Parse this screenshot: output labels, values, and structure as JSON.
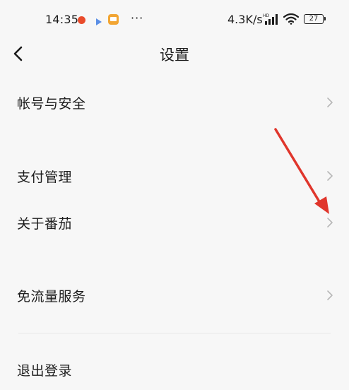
{
  "status_bar": {
    "time": "14:35",
    "more": "···",
    "network_speed": "4.3K/s",
    "signal_tag": "HD",
    "battery_level": "27"
  },
  "header": {
    "title": "设置"
  },
  "settings": {
    "items": [
      {
        "label": "帐号与安全"
      },
      {
        "label": "支付管理"
      },
      {
        "label": "关于番茄"
      },
      {
        "label": "免流量服务"
      },
      {
        "label": "退出登录"
      }
    ]
  },
  "colors": {
    "background": "#f7f7f7",
    "text": "#1c1c1c",
    "chevron": "#b8b8b8",
    "annotation_arrow": "#e0362c",
    "divider": "#e8e8e8"
  },
  "icons": {
    "back": "chevron-left-icon",
    "row": "chevron-right-icon",
    "notification": "red-dot-icon",
    "media": "play-icon",
    "app": "app-icon",
    "signal": "signal-icon",
    "wifi": "wifi-icon",
    "battery": "battery-icon"
  }
}
